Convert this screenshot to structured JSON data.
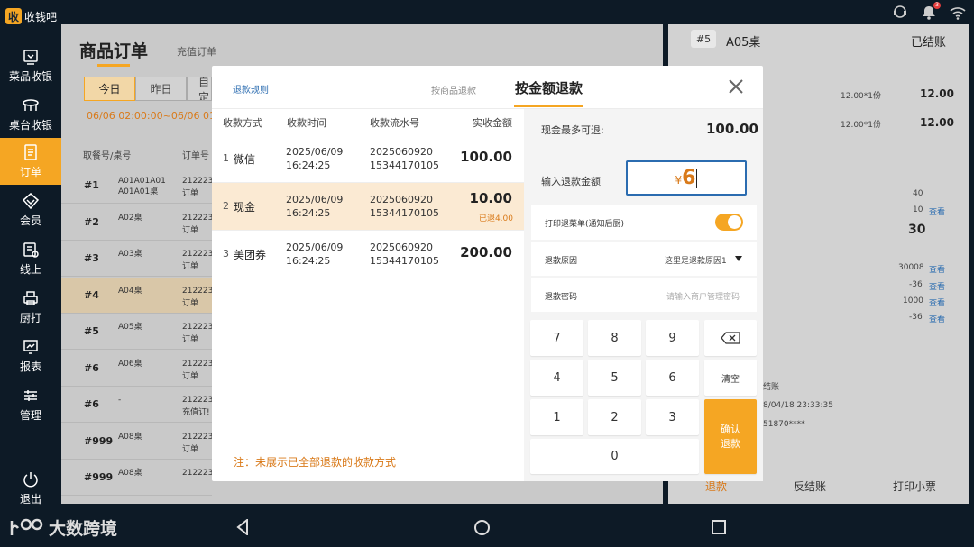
{
  "app": {
    "logo_char": "收",
    "logo_text": "收钱吧"
  },
  "status_bar": {
    "icons": [
      "assistant-icon",
      "bell-icon",
      "wifi-icon"
    ],
    "bell_badge": "3"
  },
  "sidebar": {
    "items": [
      {
        "label": "菜品收银",
        "icon": "cart-icon"
      },
      {
        "label": "桌台收银",
        "icon": "table-icon"
      },
      {
        "label": "订单",
        "icon": "order-icon",
        "active": true
      },
      {
        "label": "会员",
        "icon": "member-icon"
      },
      {
        "label": "线上",
        "icon": "online-icon"
      },
      {
        "label": "厨打",
        "icon": "printer-icon"
      },
      {
        "label": "报表",
        "icon": "report-icon"
      },
      {
        "label": "管理",
        "icon": "settings-icon"
      }
    ],
    "exit_label": "退出"
  },
  "orders_panel": {
    "title": "商品订单",
    "sub_tab": "充值订单",
    "date_tabs": [
      "今日",
      "昨日",
      "自定"
    ],
    "date_range": "06/06 02:00:00~06/06 01",
    "headers": {
      "num_table": "取餐号/桌号",
      "order_no": "订单号"
    },
    "rows": [
      {
        "num": "#1",
        "table": "A01A01A01\nA01A01桌",
        "order": "212223\n订单"
      },
      {
        "num": "#2",
        "table": "A02桌",
        "order": "212223\n订单"
      },
      {
        "num": "#3",
        "table": "A03桌",
        "order": "212223\n订单"
      },
      {
        "num": "#4",
        "table": "A04桌",
        "order": "212223\n订单",
        "selected": true
      },
      {
        "num": "#5",
        "table": "A05桌",
        "order": "212223\n订单"
      },
      {
        "num": "#6",
        "table": "A06桌",
        "order": "212223\n订单"
      },
      {
        "num": "#6",
        "table": "-",
        "order": "212223\n充值订!"
      },
      {
        "num": "#999",
        "table": "A08桌",
        "order": "212223\n订单"
      },
      {
        "num": "#999",
        "table": "A08桌",
        "order": "212223"
      }
    ]
  },
  "detail_panel": {
    "num": "#5",
    "table": "A05桌",
    "status": "已结账",
    "lines": [
      {
        "qty": "12.00*1份",
        "price": "12.00"
      },
      {
        "qty": "12.00*1份",
        "price": "12.00"
      }
    ],
    "numbers": [
      "40",
      "10",
      "30",
      "30008",
      "-36",
      "1000",
      "-36"
    ],
    "view_link": "查看",
    "info": [
      "结账",
      "8/04/18 23:33:35",
      "51870****"
    ],
    "footer": {
      "refund": "退款",
      "reverse": "反结账",
      "print": "打印小票"
    }
  },
  "refund_modal": {
    "rules_link": "退款规则",
    "tab_by_goods": "按商品退款",
    "tab_by_amount": "按金额退款",
    "columns": {
      "method": "收款方式",
      "time": "收款时间",
      "serial": "收款流水号",
      "amount": "实收金额"
    },
    "payments": [
      {
        "idx": "1",
        "method": "微信",
        "date": "2025/06/09",
        "time": "16:24:25",
        "serial1": "2025060920",
        "serial2": "15344170105",
        "amount": "100.00",
        "refunded": ""
      },
      {
        "idx": "2",
        "method": "现金",
        "date": "2025/06/09",
        "time": "16:24:25",
        "serial1": "2025060920",
        "serial2": "15344170105",
        "amount": "10.00",
        "refunded": "已退4.00",
        "selected": true
      },
      {
        "idx": "3",
        "method": "美团券",
        "date": "2025/06/09",
        "time": "16:24:25",
        "serial1": "2025060920",
        "serial2": "15344170105",
        "amount": "200.00",
        "refunded": ""
      }
    ],
    "note": "注：未展示已全部退款的收款方式",
    "max_refund_label": "现金最多可退:",
    "max_refund_value": "100.00",
    "input_label": "输入退款金额",
    "currency": "¥",
    "input_value": "6",
    "print_label": "打印退菜单(通知后厨)",
    "print_enabled": true,
    "reason_label": "退款原因",
    "reason_value": "这里是退款原因1",
    "password_label": "退款密码",
    "password_placeholder": "请输入商户管理密码",
    "keypad": [
      "7",
      "8",
      "9",
      "4",
      "5",
      "6",
      "1",
      "2",
      "3",
      "0"
    ],
    "clear_label": "清空",
    "confirm_line1": "确认",
    "confirm_line2": "退款"
  },
  "bottom_bar": {
    "brand": "大数跨境"
  },
  "colors": {
    "accent": "#f5a623",
    "link": "#2b6cb0",
    "warning": "#d97a1a",
    "sidebar": "#0d1a26"
  }
}
